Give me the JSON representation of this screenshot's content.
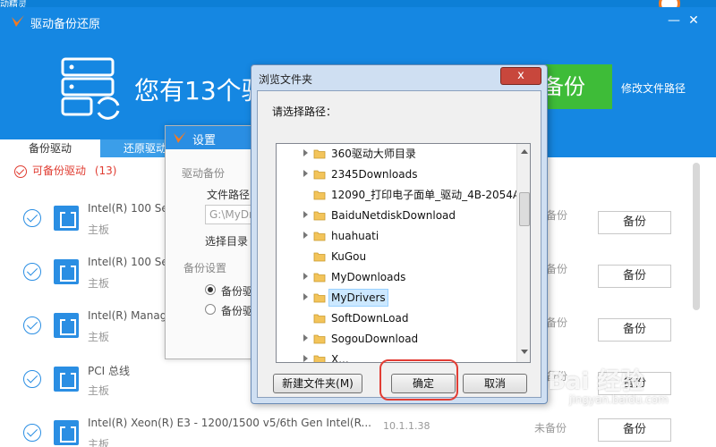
{
  "app": {
    "title": "驱动备份还原",
    "top_fragment": "动精灵",
    "banner_text": "您有13个驱",
    "backup_button": "备份",
    "modify_path_link": "修改文件路径",
    "tabs": [
      {
        "label": "备份驱动"
      },
      {
        "label": "还原驱动"
      }
    ],
    "count_label": "可备份驱动",
    "count_value": "(13)",
    "drivers": [
      {
        "name": "Intel(R) 100 Se",
        "type": "主板",
        "version": "",
        "status": "备份",
        "action": "备份"
      },
      {
        "name": "Intel(R) 100 Se",
        "type": "主板",
        "version": "",
        "status": "备份",
        "action": "备份"
      },
      {
        "name": "Intel(R) Manag",
        "type": "主板",
        "version": "",
        "status": "备份",
        "action": "备份"
      },
      {
        "name": "PCI 总线",
        "type": "主板",
        "version": "",
        "status": "备份",
        "action": "备份"
      },
      {
        "name": "Intel(R) Xeon(R) E3 - 1200/1500 v5/6th Gen Intel(R...",
        "type": "主板",
        "version": "10.1.1.38",
        "status": "未备份",
        "action": "备份"
      }
    ]
  },
  "settings": {
    "title": "设置",
    "section_backup": "驱动备份",
    "path_label": "文件路径",
    "path_value": "G:\\MyDr",
    "choose_dir_label": "选择目录",
    "section_settings": "备份设置",
    "radio_1": "备份驱",
    "radio_2": "备份驱"
  },
  "browse": {
    "title": "浏览文件夹",
    "close_label": "x",
    "prompt": "请选择路径：",
    "folders": [
      {
        "name": "360驱动大师目录",
        "expandable": true,
        "selected": false
      },
      {
        "name": "2345Downloads",
        "expandable": true,
        "selected": false
      },
      {
        "name": "12090_打印电子面单_驱动_4B-2054A",
        "expandable": false,
        "selected": false
      },
      {
        "name": "BaiduNetdiskDownload",
        "expandable": true,
        "selected": false
      },
      {
        "name": "huahuati",
        "expandable": true,
        "selected": false
      },
      {
        "name": "KuGou",
        "expandable": false,
        "selected": false
      },
      {
        "name": "MyDownloads",
        "expandable": true,
        "selected": false
      },
      {
        "name": "MyDrivers",
        "expandable": true,
        "selected": true
      },
      {
        "name": "SoftDownLoad",
        "expandable": false,
        "selected": false
      },
      {
        "name": "SogouDownload",
        "expandable": true,
        "selected": false
      },
      {
        "name": "X...",
        "expandable": true,
        "selected": false
      }
    ],
    "new_folder_button": "新建文件夹(M)",
    "ok_button": "确定",
    "cancel_button": "取消"
  },
  "watermark": {
    "text": "Bai 经验",
    "sub": "jingyan.baidu.com"
  },
  "colors": {
    "brand_blue": "#1587e2",
    "green": "#3ebc38",
    "red_accent": "#e03c31",
    "highlight": "#cce8ff"
  }
}
